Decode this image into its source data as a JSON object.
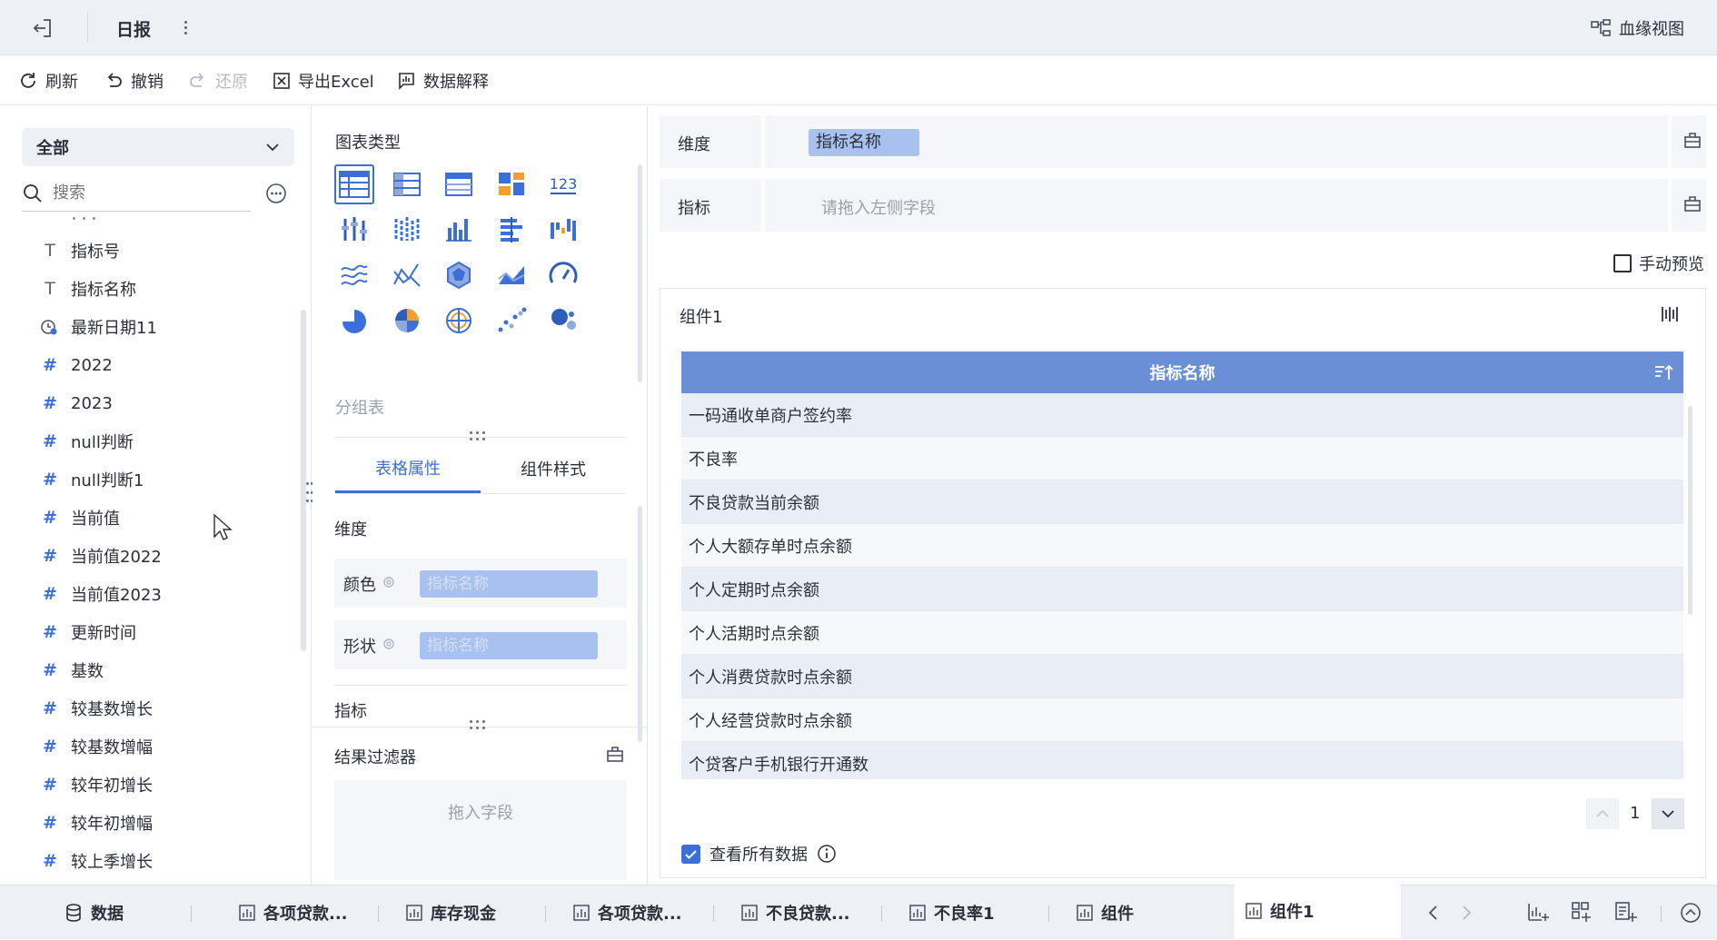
{
  "header": {
    "back_icon": "exit-icon",
    "title": "日报",
    "lineage_label": "血缘视图"
  },
  "toolbar": {
    "refresh": "刷新",
    "undo": "撤销",
    "redo": "还原",
    "export": "导出Excel",
    "explain": "数据解释"
  },
  "left": {
    "scope": "全部",
    "search_placeholder": "搜索",
    "fields": [
      {
        "type": "T",
        "label": "指标号"
      },
      {
        "type": "T",
        "label": "指标名称"
      },
      {
        "type": "date",
        "label": "最新日期11"
      },
      {
        "type": "#",
        "label": "2022"
      },
      {
        "type": "#",
        "label": "2023"
      },
      {
        "type": "#",
        "label": "null判断"
      },
      {
        "type": "#",
        "label": "null判断1"
      },
      {
        "type": "#",
        "label": "当前值"
      },
      {
        "type": "#",
        "label": "当前值2022"
      },
      {
        "type": "#",
        "label": "当前值2023"
      },
      {
        "type": "#",
        "label": "更新时间"
      },
      {
        "type": "#",
        "label": "基数"
      },
      {
        "type": "#",
        "label": "较基数增长"
      },
      {
        "type": "#",
        "label": "较基数增幅"
      },
      {
        "type": "#",
        "label": "较年初增长"
      },
      {
        "type": "#",
        "label": "较年初增幅"
      },
      {
        "type": "#",
        "label": "较上季增长"
      }
    ]
  },
  "middle": {
    "chart_type_title": "图表类型",
    "chart_type_selected": "分组表",
    "tabs": [
      "表格属性",
      "组件样式"
    ],
    "dimension_title": "维度",
    "color_label": "颜色",
    "color_value": "指标名称",
    "shape_label": "形状",
    "shape_value": "指标名称",
    "measure_title": "指标",
    "filter_title": "结果过滤器",
    "filter_placeholder": "拖入字段"
  },
  "right": {
    "dimension_label": "维度",
    "dimension_chip": "指标名称",
    "measure_label": "指标",
    "measure_placeholder": "请拖入左侧字段",
    "manual_preview": "手动预览",
    "component_title": "组件1",
    "table_header": "指标名称",
    "rows": [
      "一码通收单商户签约率",
      "不良率",
      "不良贷款当前余额",
      "个人大额存单时点余额",
      "个人定期时点余额",
      "个人活期时点余额",
      "个人消费贷款时点余额",
      "个人经营贷款时点余额",
      "个贷客户手机银行开通数"
    ],
    "page": "1",
    "view_all": "查看所有数据"
  },
  "bottom_tabs": {
    "data": "数据",
    "tabs": [
      "各项贷款...",
      "库存现金",
      "各项贷款...",
      "不良贷款...",
      "不良率1",
      "组件",
      "组件1"
    ],
    "active": "组件1"
  },
  "colors": {
    "accent": "#3d6fd8",
    "header_bg": "#6b8fd6",
    "chip_bg": "#a9c1ee"
  }
}
